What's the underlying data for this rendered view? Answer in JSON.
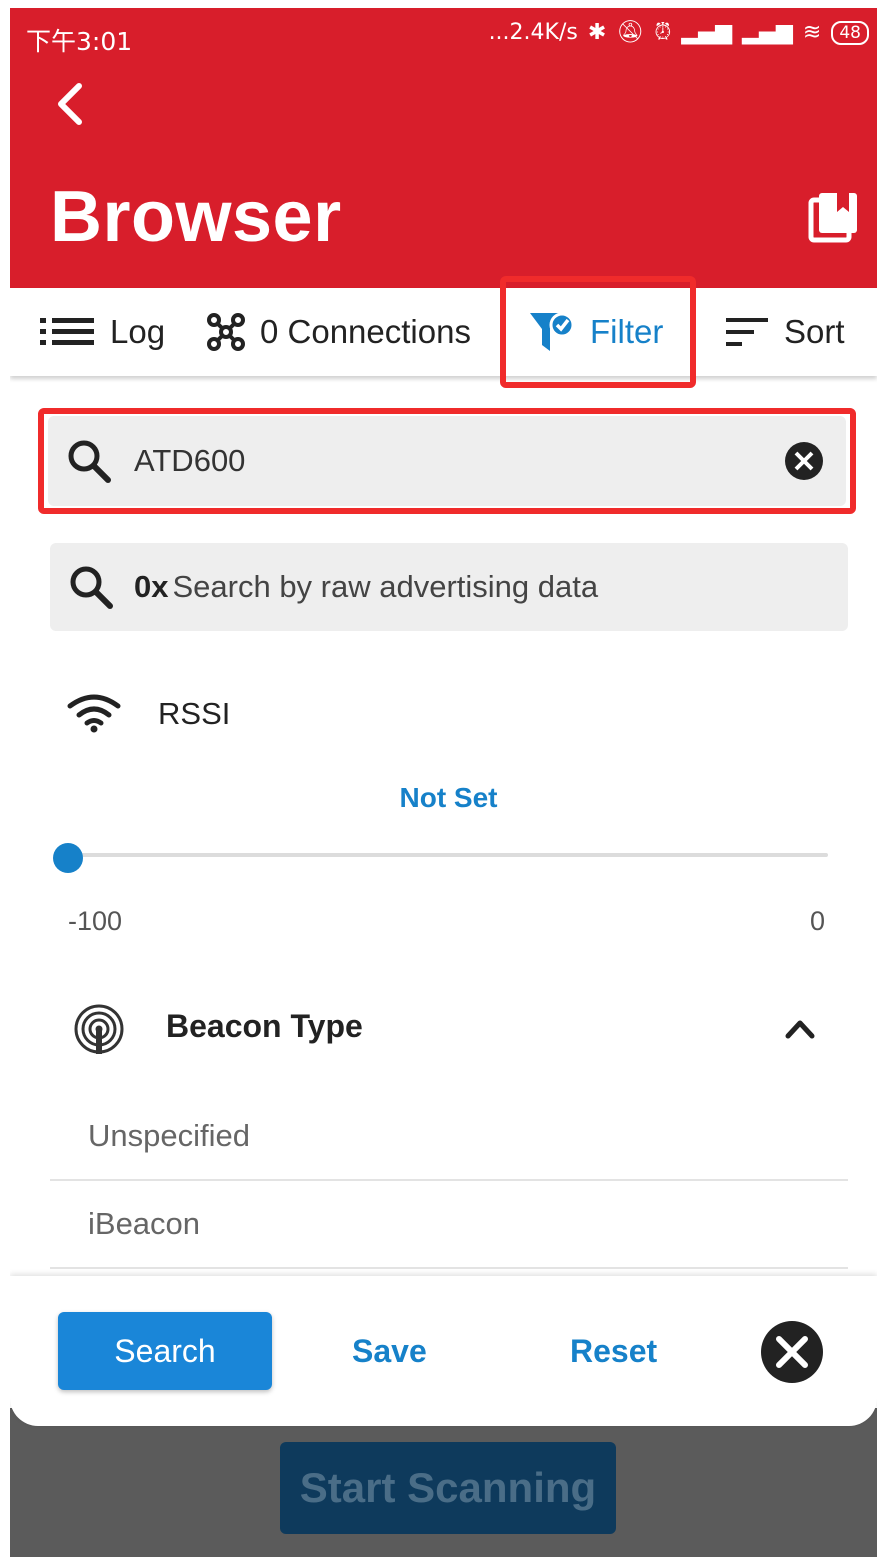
{
  "status_bar": {
    "time": "下午3:01",
    "network_speed": "...2.4K/s",
    "battery": "48"
  },
  "app": {
    "title": "Browser"
  },
  "toolbar": {
    "log_label": "Log",
    "connections_label": "0 Connections",
    "filter_label": "Filter",
    "sort_label": "Sort"
  },
  "filter": {
    "name_search_value": "ATD600",
    "raw_search_prefix": "0x",
    "raw_search_placeholder": "Search by raw advertising data",
    "rssi": {
      "label": "RSSI",
      "value_text": "Not Set",
      "min_label": "-100",
      "max_label": "0",
      "value_fraction": 0
    },
    "beacon_type": {
      "label": "Beacon Type",
      "options": [
        "Unspecified",
        "iBeacon"
      ]
    }
  },
  "actions": {
    "search_label": "Search",
    "save_label": "Save",
    "reset_label": "Reset"
  },
  "background": {
    "start_scanning_label": "Start Scanning"
  },
  "colors": {
    "appbar": "#d81e2b",
    "accent": "#1681c9",
    "highlight": "#f02b2b"
  }
}
